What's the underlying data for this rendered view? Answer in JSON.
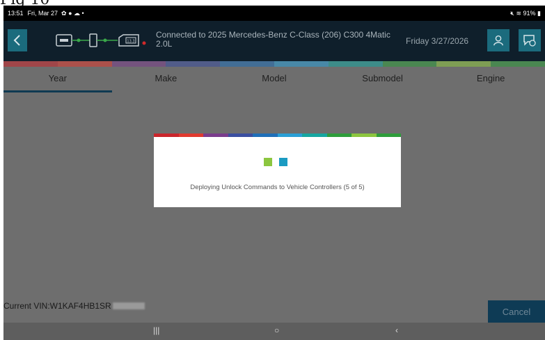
{
  "figure": {
    "label": "Fig 10"
  },
  "status_bar": {
    "time": "13:51",
    "date": "Fri, Mar 27",
    "battery": "91%"
  },
  "header": {
    "back_icon": "chevron-left-icon",
    "connection_text": "Connected to 2025 Mercedes-Benz C-Class (206) C300 4Matic 2.0L",
    "voltage": "13.3",
    "date": "Friday 3/27/2026",
    "accent": "#1b6b7d"
  },
  "tabs": [
    {
      "label": "Year",
      "active": true
    },
    {
      "label": "Make",
      "active": false
    },
    {
      "label": "Model",
      "active": false
    },
    {
      "label": "Submodel",
      "active": false
    },
    {
      "label": "Engine",
      "active": false
    }
  ],
  "dialog": {
    "message": "Deploying Unlock Commands to Vehicle Controllers (5 of 5)"
  },
  "footer": {
    "vin_label": "Current VIN:W1KAF4HB1SR",
    "cancel_label": "Cancel"
  },
  "colors": {
    "stripe": [
      "#c9262c",
      "#e03a2f",
      "#7a3d8c",
      "#3b4fa0",
      "#1f6fb8",
      "#2a9fd6",
      "#16a6a0",
      "#2e9d3b",
      "#8cc63f",
      "#2e9d3b"
    ]
  }
}
